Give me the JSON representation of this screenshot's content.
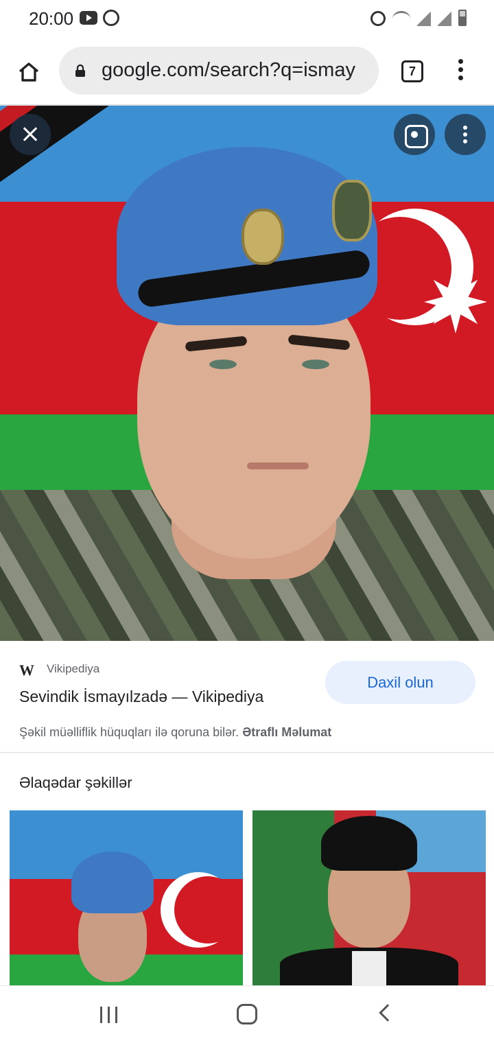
{
  "status_bar": {
    "time": "20:00"
  },
  "browser": {
    "url": "google.com/search?q=ismay",
    "tab_count": "7"
  },
  "source": {
    "site_name": "Vikipediya",
    "page_title": "Sevindik İsmayılzadə — Vikipediya",
    "visit_label": "Daxil olun",
    "copyright_text": "Şəkil müəlliflik hüquqları ilə qoruna bilər.",
    "copyright_link": "Ətraflı Məlumat"
  },
  "related": {
    "title": "Əlaqədar şəkillər"
  },
  "icons": {
    "home": "home-icon",
    "lock": "lock-icon",
    "tabs": "tabs-icon",
    "menu": "more-vert-icon",
    "close": "close-icon",
    "lens": "lens-icon",
    "wikipedia": "wikipedia-icon"
  },
  "colors": {
    "accent": "#1967d2",
    "visit_button_bg": "#e8f0fe"
  }
}
